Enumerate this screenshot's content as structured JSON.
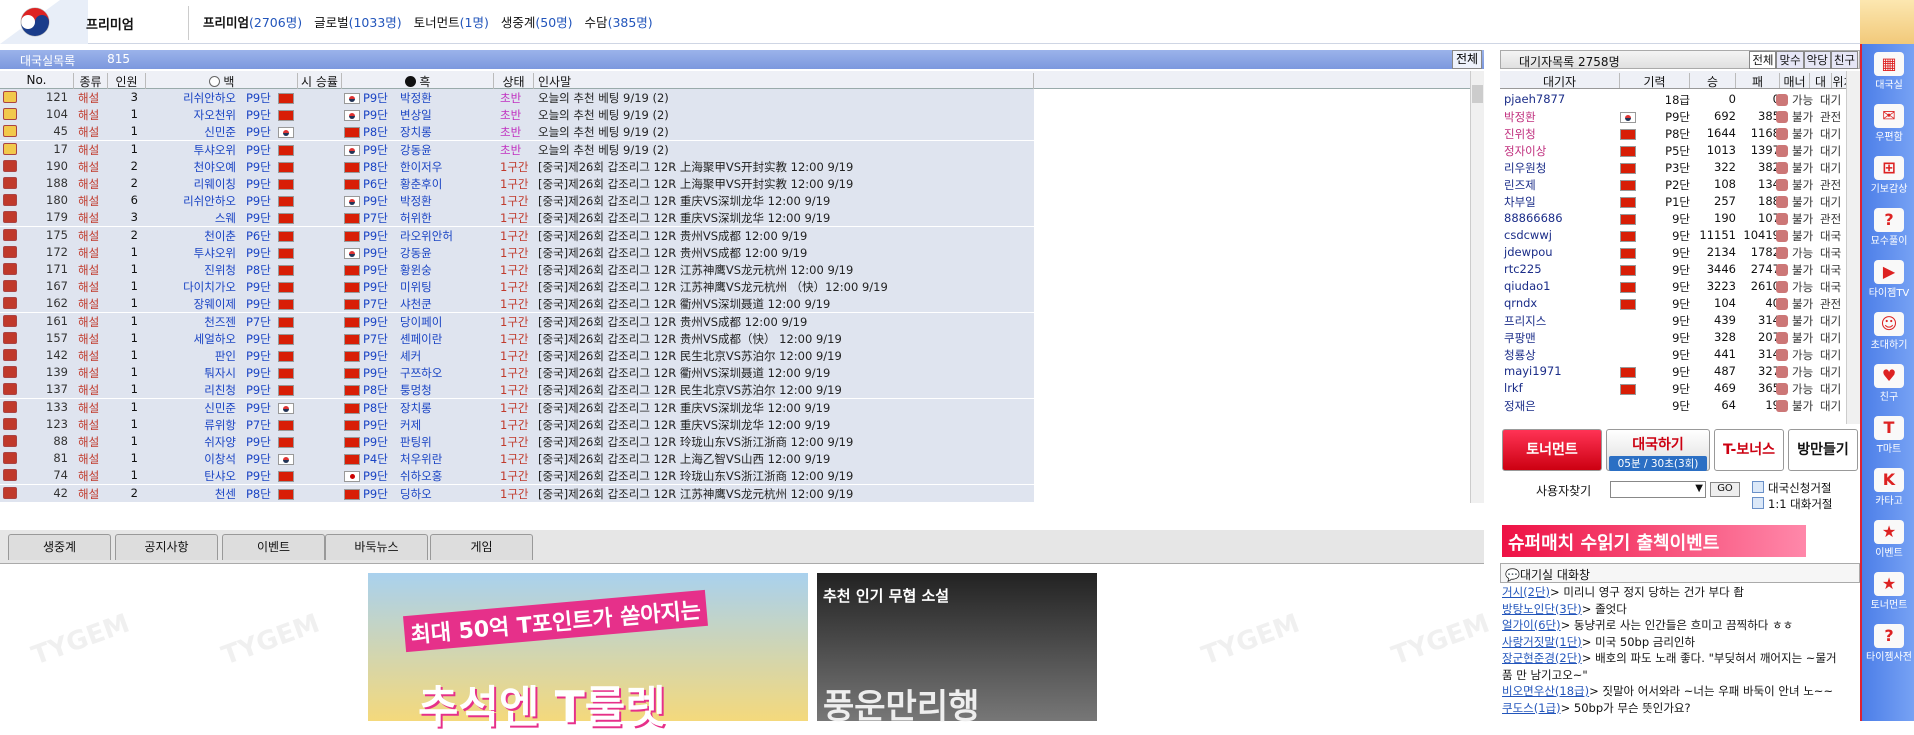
{
  "top": {
    "premium_label": "프리미엄",
    "categories": [
      {
        "name": "프리미엄",
        "count": "(2706명)"
      },
      {
        "name": "글로벌",
        "count": "(1033명)"
      },
      {
        "name": "토너먼트",
        "count": "(1명)"
      },
      {
        "name": "생중계",
        "count": "(50명)"
      },
      {
        "name": "수담",
        "count": "(385명)"
      }
    ]
  },
  "left": {
    "title": "대국실목록",
    "count": "815개",
    "all_button": "전체",
    "headers": [
      "No.",
      "종류",
      "인원",
      "백",
      "시 승률",
      "흑",
      "상태",
      "인사말"
    ],
    "rows": [
      {
        "no": "121",
        "kind": "해설",
        "n": "3",
        "w": "리쉬안하오",
        "wr": "P9단",
        "wf": "cn",
        "bf": "kr",
        "br": "P9단",
        "b": "박정환",
        "st": "초반",
        "msg": "오늘의 추천 베팅 9/19 (2)"
      },
      {
        "no": "104",
        "kind": "해설",
        "n": "1",
        "w": "자오천위",
        "wr": "P9단",
        "wf": "cn",
        "bf": "kr",
        "br": "P9단",
        "b": "변상일",
        "st": "초반",
        "msg": "오늘의 추천 베팅 9/19 (2)"
      },
      {
        "no": "45",
        "kind": "해설",
        "n": "1",
        "w": "신민준",
        "wr": "P9단",
        "wf": "kr",
        "bf": "cn",
        "br": "P8단",
        "b": "장치롱",
        "st": "초반",
        "msg": "오늘의 추천 베팅 9/19 (2)"
      },
      {
        "no": "17",
        "kind": "해설",
        "n": "1",
        "w": "투샤오위",
        "wr": "P9단",
        "wf": "cn",
        "bf": "kr",
        "br": "P9단",
        "b": "강동윤",
        "st": "초반",
        "msg": "오늘의 추천 베팅 9/19 (2)"
      },
      {
        "no": "190",
        "kind": "해설",
        "n": "2",
        "w": "천야오예",
        "wr": "P9단",
        "wf": "cn",
        "bf": "cn",
        "br": "P8단",
        "b": "한이저우",
        "st": "1구간",
        "msg": "[중국]제26회 갑조리그 12R 上海聚甲VS开封实教 12:00 9/19"
      },
      {
        "no": "188",
        "kind": "해설",
        "n": "2",
        "w": "리웨이칭",
        "wr": "P9단",
        "wf": "cn",
        "bf": "cn",
        "br": "P6단",
        "b": "황춘후이",
        "st": "1구간",
        "msg": "[중국]제26회 갑조리그 12R 上海聚甲VS开封实教 12:00 9/19"
      },
      {
        "no": "180",
        "kind": "해설",
        "n": "6",
        "w": "리쉬안하오",
        "wr": "P9단",
        "wf": "cn",
        "bf": "kr",
        "br": "P9단",
        "b": "박정환",
        "st": "1구간",
        "msg": "[중국]제26회 갑조리그 12R 重庆VS深圳龙华 12:00 9/19"
      },
      {
        "no": "179",
        "kind": "해설",
        "n": "3",
        "w": "스웨",
        "wr": "P9단",
        "wf": "cn",
        "bf": "cn",
        "br": "P7단",
        "b": "허위한",
        "st": "1구간",
        "msg": "[중국]제26회 갑조리그 12R 重庆VS深圳龙华 12:00 9/19"
      },
      {
        "no": "175",
        "kind": "해설",
        "n": "2",
        "w": "천이춘",
        "wr": "P6단",
        "wf": "cn",
        "bf": "cn",
        "br": "P9단",
        "b": "라오위안허",
        "st": "1구간",
        "msg": "[중국]제26회 갑조리그 12R 贵州VS成都 12:00 9/19"
      },
      {
        "no": "172",
        "kind": "해설",
        "n": "1",
        "w": "투샤오위",
        "wr": "P9단",
        "wf": "cn",
        "bf": "kr",
        "br": "P9단",
        "b": "강동윤",
        "st": "1구간",
        "msg": "[중국]제26회 갑조리그 12R 贵州VS成都 12:00 9/19"
      },
      {
        "no": "171",
        "kind": "해설",
        "n": "1",
        "w": "진위청",
        "wr": "P8단",
        "wf": "cn",
        "bf": "cn",
        "br": "P9단",
        "b": "황윈숭",
        "st": "1구간",
        "msg": "[중국]제26회 갑조리그 12R 江苏神鹰VS龙元杭州 12:00 9/19"
      },
      {
        "no": "167",
        "kind": "해설",
        "n": "1",
        "w": "다이치가오",
        "wr": "P9단",
        "wf": "cn",
        "bf": "cn",
        "br": "P9단",
        "b": "미위팅",
        "st": "1구간",
        "msg": "[중국]제26회 갑조리그 12R 江苏神鹰VS龙元杭州 （快）12:00 9/19"
      },
      {
        "no": "162",
        "kind": "해설",
        "n": "1",
        "w": "장웨이제",
        "wr": "P9단",
        "wf": "cn",
        "bf": "cn",
        "br": "P7단",
        "b": "샤천쿤",
        "st": "1구간",
        "msg": "[중국]제26회 갑조리그 12R 衢州VS深圳聂道 12:00 9/19"
      },
      {
        "no": "161",
        "kind": "해설",
        "n": "1",
        "w": "천즈젠",
        "wr": "P7단",
        "wf": "cn",
        "bf": "cn",
        "br": "P9단",
        "b": "당이페이",
        "st": "1구간",
        "msg": "[중국]제26회 갑조리그 12R 贵州VS成都 12:00 9/19"
      },
      {
        "no": "157",
        "kind": "해설",
        "n": "1",
        "w": "세얼하오",
        "wr": "P9단",
        "wf": "cn",
        "bf": "cn",
        "br": "P7단",
        "b": "셴페이란",
        "st": "1구간",
        "msg": "[중국]제26회 갑조리그 12R 贵州VS成都（快） 12:00 9/19"
      },
      {
        "no": "142",
        "kind": "해설",
        "n": "1",
        "w": "판인",
        "wr": "P9단",
        "wf": "cn",
        "bf": "cn",
        "br": "P9단",
        "b": "셰커",
        "st": "1구간",
        "msg": "[중국]제26회 갑조리그 12R 民生北京VS苏泊尔 12:00 9/19"
      },
      {
        "no": "139",
        "kind": "해설",
        "n": "1",
        "w": "퉈자시",
        "wr": "P9단",
        "wf": "cn",
        "bf": "cn",
        "br": "P9단",
        "b": "구쯔하오",
        "st": "1구간",
        "msg": "[중국]제26회 갑조리그 12R 衢州VS深圳聂道 12:00 9/19"
      },
      {
        "no": "137",
        "kind": "해설",
        "n": "1",
        "w": "리친청",
        "wr": "P9단",
        "wf": "cn",
        "bf": "cn",
        "br": "P8단",
        "b": "퉁멍청",
        "st": "1구간",
        "msg": "[중국]제26회 갑조리그 12R 民生北京VS苏泊尔 12:00 9/19"
      },
      {
        "no": "133",
        "kind": "해설",
        "n": "1",
        "w": "신민준",
        "wr": "P9단",
        "wf": "kr",
        "bf": "cn",
        "br": "P8단",
        "b": "장치롱",
        "st": "1구간",
        "msg": "[중국]제26회 갑조리그 12R 重庆VS深圳龙华 12:00 9/19"
      },
      {
        "no": "123",
        "kind": "해설",
        "n": "1",
        "w": "류위항",
        "wr": "P7단",
        "wf": "cn",
        "bf": "cn",
        "br": "P9단",
        "b": "커제",
        "st": "1구간",
        "msg": "[중국]제26회 갑조리그 12R 重庆VS深圳龙华 12:00 9/19"
      },
      {
        "no": "88",
        "kind": "해설",
        "n": "1",
        "w": "쉬자양",
        "wr": "P9단",
        "wf": "cn",
        "bf": "cn",
        "br": "P9단",
        "b": "판팅위",
        "st": "1구간",
        "msg": "[중국]제26회 갑조리그 12R 玲珑山东VS浙江浙商 12:00 9/19"
      },
      {
        "no": "81",
        "kind": "해설",
        "n": "1",
        "w": "이창석",
        "wr": "P9단",
        "wf": "kr",
        "bf": "cn",
        "br": "P4단",
        "b": "처우위란",
        "st": "1구간",
        "msg": "[중국]제26회 갑조리그 12R 上海乙智VS山西 12:00 9/19"
      },
      {
        "no": "74",
        "kind": "해설",
        "n": "1",
        "w": "탄샤오",
        "wr": "P9단",
        "wf": "cn",
        "bf": "jp",
        "br": "P9단",
        "b": "쉬하오홍",
        "st": "1구간",
        "msg": "[중국]제26회 갑조리그 12R 玲珑山东VS浙江浙商 12:00 9/19"
      },
      {
        "no": "42",
        "kind": "해설",
        "n": "2",
        "w": "천센",
        "wr": "P8단",
        "wf": "cn",
        "bf": "cn",
        "br": "P9단",
        "b": "딩하오",
        "st": "1구간",
        "msg": "[중국]제26회 갑조리그 12R 江苏神鹰VS龙元杭州 12:00 9/19"
      }
    ]
  },
  "tabs": [
    "생중계",
    "공지사항",
    "이벤트",
    "바둑뉴스",
    "게임"
  ],
  "ads": {
    "ad1_line1": "최대 50억 T포인트가 쏟아지는",
    "ad1_line2": "추석엔 T룰렛",
    "ad2_title": "추천 인기 무협 소설",
    "ad2_body": "풍운만리행"
  },
  "right": {
    "title": "대기자목록",
    "count": "2758명",
    "tabs": [
      "전체",
      "맞수",
      "악당",
      "친구"
    ],
    "headers": [
      "대기자",
      "기력",
      "승",
      "패",
      "매너",
      "대국",
      "위치"
    ],
    "rows": [
      {
        "n": "pjaeh7877",
        "f": "",
        "r": "18급",
        "w": "0",
        "l": "0",
        "a": "가능",
        "s": "대기",
        "red": false
      },
      {
        "n": "박정환",
        "f": "kr",
        "r": "P9단",
        "w": "692",
        "l": "385",
        "a": "불가",
        "s": "관전",
        "red": true
      },
      {
        "n": "진위청",
        "f": "cn",
        "r": "P8단",
        "w": "1644",
        "l": "1168",
        "a": "불가",
        "s": "대기",
        "red": true
      },
      {
        "n": "정자이상",
        "f": "cn",
        "r": "P5단",
        "w": "1013",
        "l": "1397",
        "a": "불가",
        "s": "대기",
        "red": true
      },
      {
        "n": "리우원청",
        "f": "cn",
        "r": "P3단",
        "w": "322",
        "l": "382",
        "a": "불가",
        "s": "대기",
        "red": false
      },
      {
        "n": "린즈제",
        "f": "cn",
        "r": "P2단",
        "w": "108",
        "l": "134",
        "a": "불가",
        "s": "관전",
        "red": false
      },
      {
        "n": "차부일",
        "f": "cn",
        "r": "P1단",
        "w": "257",
        "l": "188",
        "a": "불가",
        "s": "대기",
        "red": false
      },
      {
        "n": "88866686",
        "f": "cn",
        "r": "9단",
        "w": "190",
        "l": "107",
        "a": "불가",
        "s": "관전",
        "red": false
      },
      {
        "n": "csdcwwj",
        "f": "cn",
        "r": "9단",
        "w": "11151",
        "l": "10419",
        "a": "불가",
        "s": "대국",
        "red": false
      },
      {
        "n": "jdewpou",
        "f": "cn",
        "r": "9단",
        "w": "2134",
        "l": "1782",
        "a": "가능",
        "s": "대국",
        "red": false
      },
      {
        "n": "rtc225",
        "f": "cn",
        "r": "9단",
        "w": "3446",
        "l": "2747",
        "a": "불가",
        "s": "대국",
        "red": false
      },
      {
        "n": "qiudao1",
        "f": "cn",
        "r": "9단",
        "w": "3223",
        "l": "2610",
        "a": "가능",
        "s": "대국",
        "red": false
      },
      {
        "n": "qrndx",
        "f": "cn",
        "r": "9단",
        "w": "104",
        "l": "40",
        "a": "불가",
        "s": "관전",
        "red": false
      },
      {
        "n": "프리지스",
        "f": "",
        "r": "9단",
        "w": "439",
        "l": "314",
        "a": "불가",
        "s": "대기",
        "red": false
      },
      {
        "n": "쿠팡맨",
        "f": "",
        "r": "9단",
        "w": "328",
        "l": "207",
        "a": "불가",
        "s": "대기",
        "red": false
      },
      {
        "n": "청룡상",
        "f": "",
        "r": "9단",
        "w": "441",
        "l": "314",
        "a": "가능",
        "s": "대기",
        "red": false
      },
      {
        "n": "mayi1971",
        "f": "cn",
        "r": "9단",
        "w": "487",
        "l": "327",
        "a": "가능",
        "s": "대기",
        "red": false
      },
      {
        "n": "lrkf",
        "f": "cn",
        "r": "9단",
        "w": "469",
        "l": "365",
        "a": "가능",
        "s": "대기",
        "red": false
      },
      {
        "n": "정재은",
        "f": "",
        "r": "9단",
        "w": "64",
        "l": "19",
        "a": "불가",
        "s": "대기",
        "red": false
      }
    ]
  },
  "buttons": {
    "tournament": "토너먼트",
    "play": "대국하기",
    "play_sub": "05분 / 30초(3회)",
    "tbonus": "T-보너스",
    "make_room": "방만들기"
  },
  "search": {
    "label": "사용자찾기",
    "go": "GO",
    "opt1": "대국신청거절",
    "opt2": "1:1 대화거절"
  },
  "banner": "슈퍼매치 수읽기 출첵이벤트",
  "chat": {
    "title": "대기실 대화창",
    "lines": [
      {
        "u": "거시(2단)",
        "t": "> 미리니 영구 정지 당하는 건가 부다 좝"
      },
      {
        "u": "방탕노인단(3단)",
        "t": "> 졸엇다"
      },
      {
        "u": "얼가이(6단)",
        "t": "> 동냥귀로 사는 인간들은 흐미고 끔찍하다 ㅎㅎ"
      },
      {
        "u": "사랑거짓말(1단)",
        "t": "> 미국 50bp 금리인하"
      },
      {
        "u": "장군현준경(2단)",
        "t": "> 배호의 파도 노래 좋다. \"부딪혀서 깨어지는 ~물거품 만 남기고오~\""
      },
      {
        "u": "비오면우산(18급)",
        "t": "> 짓말아 어서와라 ~너는 우패 바둑이 안녀 노~~"
      },
      {
        "u": "쿠도스(1급)",
        "t": "> 50bp가 무슨 뜻인가요?"
      }
    ]
  },
  "side": [
    "대국실",
    "우편함",
    "기보감상",
    "묘수풀이",
    "타이젬TV",
    "초대하기",
    "친구",
    "T마트",
    "카타고",
    "이벤트",
    "토너먼트",
    "타이젬사전"
  ]
}
